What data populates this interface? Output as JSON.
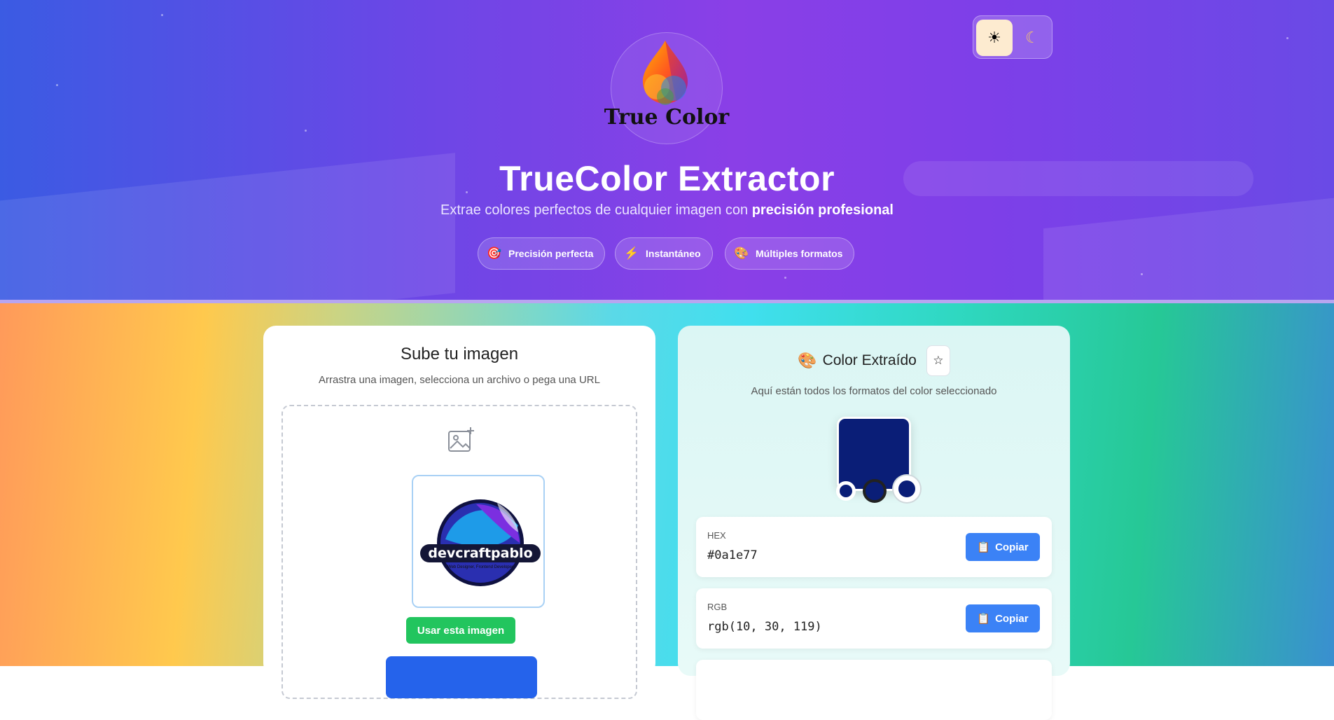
{
  "theme_toggle": {
    "light_icon": "☀",
    "dark_icon": "☾"
  },
  "logo": {
    "text": "True Color"
  },
  "hero": {
    "title": "TrueColor Extractor",
    "subtitle_prefix": "Extrae colores perfectos de cualquier imagen con ",
    "subtitle_bold": "precisión profesional",
    "pills": [
      {
        "icon": "target-icon",
        "glyph": "🎯",
        "label": "Precisión perfecta"
      },
      {
        "icon": "lightning-icon",
        "glyph": "⚡",
        "label": "Instantáneo"
      },
      {
        "icon": "palette-icon",
        "glyph": "🎨",
        "label": "Múltiples formatos"
      }
    ]
  },
  "upload": {
    "title": "Sube tu imagen",
    "subtitle": "Arrastra una imagen, selecciona un archivo o pega una URL",
    "preview_logo_text": "devcraftpablo",
    "preview_logo_tagline": "Web Designer, Frontend Developer",
    "use_button": "Usar esta imagen"
  },
  "result": {
    "title_icon": "🎨",
    "title": "Color Extraído",
    "favorite_icon": "☆",
    "subtitle": "Aquí están todos los formatos del color seleccionado",
    "swatch_color": "#0a1e77",
    "formats": [
      {
        "label": "HEX",
        "value": "#0a1e77",
        "button": "Copiar"
      },
      {
        "label": "RGB",
        "value": "rgb(10, 30, 119)",
        "button": "Copiar"
      }
    ]
  },
  "colors": {
    "accent_blue": "#3b82f6",
    "success_green": "#22c55e",
    "primary_blue": "#2563eb"
  }
}
